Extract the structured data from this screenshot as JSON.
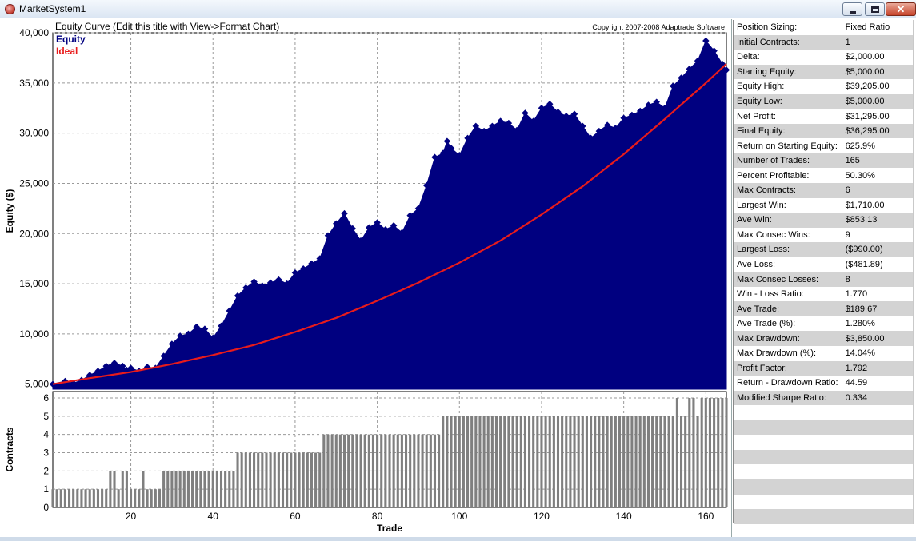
{
  "window": {
    "title": "MarketSystem1",
    "minimize_icon": "minimize-icon",
    "maximize_icon": "maximize-icon",
    "close_icon": "close-icon"
  },
  "chart_data": [
    {
      "type": "area",
      "title": "Equity Curve (Edit this title with View->Format Chart)",
      "copyright": "Copyright 2007-2008 Adaptrade Software",
      "xlabel": "",
      "ylabel": "Equity ($)",
      "ylim": [
        4500,
        40000
      ],
      "yticks": [
        5000,
        10000,
        15000,
        20000,
        25000,
        30000,
        35000,
        40000
      ],
      "ytick_labels": [
        "5,000",
        "10,000",
        "15,000",
        "20,000",
        "25,000",
        "30,000",
        "35,000",
        "40,000"
      ],
      "grid": true,
      "legend_placement": "top-left",
      "series": [
        {
          "name": "Equity",
          "color": "#000080",
          "x": [
            1,
            4,
            6,
            8,
            10,
            12,
            14,
            16,
            18,
            19,
            20,
            22,
            24,
            26,
            28,
            30,
            32,
            34,
            36,
            38,
            40,
            42,
            44,
            46,
            48,
            50,
            52,
            54,
            56,
            58,
            60,
            62,
            64,
            66,
            68,
            70,
            72,
            74,
            76,
            78,
            80,
            82,
            84,
            86,
            88,
            90,
            92,
            94,
            96,
            97,
            98,
            100,
            102,
            104,
            106,
            108,
            110,
            112,
            114,
            116,
            118,
            120,
            122,
            124,
            126,
            128,
            130,
            132,
            134,
            136,
            138,
            140,
            142,
            144,
            146,
            148,
            150,
            152,
            154,
            156,
            158,
            160,
            162,
            164,
            165
          ],
          "values": [
            5000,
            5300,
            5100,
            5400,
            5900,
            6300,
            6800,
            7100,
            6800,
            6400,
            6600,
            6300,
            6700,
            6600,
            7800,
            9000,
            9800,
            10000,
            10700,
            10500,
            9600,
            10800,
            12300,
            13800,
            14600,
            15200,
            14800,
            15100,
            15400,
            15000,
            16100,
            16500,
            17000,
            17500,
            19800,
            21000,
            22000,
            20500,
            19300,
            20600,
            21100,
            20400,
            20800,
            20100,
            21800,
            22500,
            24800,
            27600,
            28000,
            29200,
            28500,
            27800,
            29500,
            30700,
            30200,
            30700,
            31200,
            31000,
            30300,
            32000,
            31200,
            32500,
            32900,
            32100,
            31700,
            31900,
            30700,
            29500,
            30200,
            30800,
            30500,
            31500,
            31800,
            32200,
            32800,
            33100,
            32500,
            34700,
            35500,
            36400,
            37200,
            39205,
            38200,
            36900,
            36295
          ]
        },
        {
          "name": "Ideal",
          "color": "#e81b1b",
          "x": [
            1,
            10,
            20,
            30,
            40,
            50,
            60,
            70,
            80,
            90,
            100,
            110,
            120,
            130,
            140,
            150,
            160,
            165
          ],
          "values": [
            5000,
            5600,
            6200,
            7000,
            7900,
            8900,
            10200,
            11600,
            13300,
            15100,
            17100,
            19300,
            21900,
            24700,
            27900,
            31400,
            35000,
            36900
          ]
        }
      ]
    },
    {
      "type": "bar",
      "xlabel": "Trade",
      "ylabel": "Contracts",
      "xlim": [
        1,
        165
      ],
      "ylim": [
        0,
        6
      ],
      "yticks": [
        0,
        1,
        2,
        3,
        4,
        5,
        6
      ],
      "xticks": [
        20,
        40,
        60,
        80,
        100,
        120,
        140,
        160
      ],
      "grid": true,
      "color": "#7f7f7f",
      "segments": [
        {
          "from": 1,
          "to": 14,
          "value": 1
        },
        {
          "from": 15,
          "to": 16,
          "value": 2
        },
        {
          "from": 17,
          "to": 17,
          "value": 1
        },
        {
          "from": 18,
          "to": 19,
          "value": 2
        },
        {
          "from": 20,
          "to": 22,
          "value": 1
        },
        {
          "from": 23,
          "to": 23,
          "value": 2
        },
        {
          "from": 24,
          "to": 27,
          "value": 1
        },
        {
          "from": 28,
          "to": 45,
          "value": 2
        },
        {
          "from": 46,
          "to": 66,
          "value": 3
        },
        {
          "from": 67,
          "to": 95,
          "value": 4
        },
        {
          "from": 96,
          "to": 152,
          "value": 5
        },
        {
          "from": 153,
          "to": 153,
          "value": 6
        },
        {
          "from": 154,
          "to": 155,
          "value": 5
        },
        {
          "from": 156,
          "to": 157,
          "value": 6
        },
        {
          "from": 158,
          "to": 158,
          "value": 5
        },
        {
          "from": 159,
          "to": 165,
          "value": 6
        }
      ]
    }
  ],
  "stats": [
    {
      "label": "Position Sizing:",
      "value": "Fixed Ratio"
    },
    {
      "label": "Initial Contracts:",
      "value": "1"
    },
    {
      "label": "Delta:",
      "value": "$2,000.00"
    },
    {
      "label": "Starting Equity:",
      "value": "$5,000.00"
    },
    {
      "label": "Equity High:",
      "value": "$39,205.00"
    },
    {
      "label": "Equity Low:",
      "value": "$5,000.00"
    },
    {
      "label": "Net Profit:",
      "value": "$31,295.00"
    },
    {
      "label": "Final Equity:",
      "value": "$36,295.00"
    },
    {
      "label": "Return on Starting Equity:",
      "value": "625.9%"
    },
    {
      "label": "Number of Trades:",
      "value": "165"
    },
    {
      "label": "Percent Profitable:",
      "value": "50.30%"
    },
    {
      "label": "Max Contracts:",
      "value": "6"
    },
    {
      "label": "Largest Win:",
      "value": "$1,710.00"
    },
    {
      "label": "Ave Win:",
      "value": "$853.13"
    },
    {
      "label": "Max Consec Wins:",
      "value": "9"
    },
    {
      "label": "Largest Loss:",
      "value": "($990.00)"
    },
    {
      "label": "Ave Loss:",
      "value": "($481.89)"
    },
    {
      "label": "Max Consec Losses:",
      "value": "8"
    },
    {
      "label": "Win - Loss Ratio:",
      "value": "1.770"
    },
    {
      "label": "Ave Trade:",
      "value": "$189.67"
    },
    {
      "label": "Ave Trade (%):",
      "value": "1.280%"
    },
    {
      "label": "Max Drawdown:",
      "value": "$3,850.00"
    },
    {
      "label": "Max Drawdown (%):",
      "value": "14.04%"
    },
    {
      "label": "Profit Factor:",
      "value": "1.792"
    },
    {
      "label": "Return - Drawdown Ratio:",
      "value": "44.59"
    },
    {
      "label": "Modified Sharpe Ratio:",
      "value": "0.334"
    },
    {
      "label": "",
      "value": ""
    },
    {
      "label": "",
      "value": ""
    },
    {
      "label": "",
      "value": ""
    },
    {
      "label": "",
      "value": ""
    },
    {
      "label": "",
      "value": ""
    },
    {
      "label": "",
      "value": ""
    },
    {
      "label": "",
      "value": ""
    },
    {
      "label": "",
      "value": ""
    }
  ]
}
